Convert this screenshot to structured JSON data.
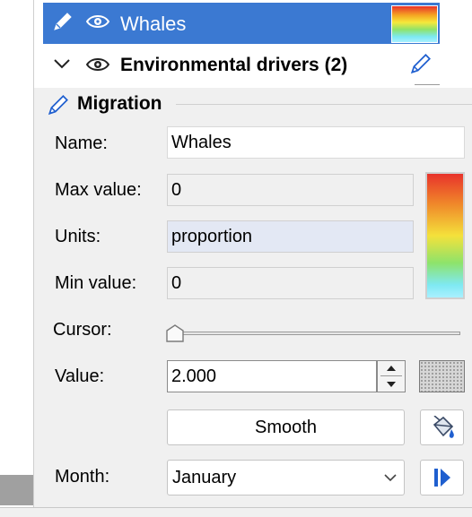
{
  "tree": {
    "selected_item": {
      "label": "Whales"
    },
    "group_item": {
      "label": "Environmental drivers (2)"
    }
  },
  "group": {
    "title": "Migration"
  },
  "form": {
    "name_label": "Name:",
    "name_value": "Whales",
    "max_label": "Max value:",
    "max_value": "0",
    "units_label": "Units:",
    "units_value": "proportion",
    "min_label": "Min value:",
    "min_value": "0",
    "cursor_label": "Cursor:",
    "cursor_position": 0,
    "value_label": "Value:",
    "value_value": "2.000",
    "smooth_button": "Smooth",
    "month_label": "Month:",
    "month_value": "January"
  },
  "colors": {
    "selection": "#3b79d2",
    "accent_blue": "#1f5fcf",
    "units_field_bg": "#e3e8f4"
  },
  "icons": [
    "pencil-icon",
    "eye-icon",
    "chevron-down-icon",
    "paint-bucket-icon",
    "play-step-icon",
    "spin-up-icon",
    "spin-down-icon"
  ]
}
